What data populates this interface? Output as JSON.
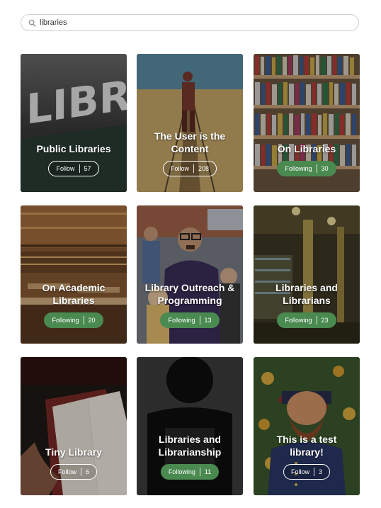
{
  "search": {
    "value": "libraries",
    "placeholder": ""
  },
  "cards": [
    {
      "title": "Public Libraries",
      "button_label": "Follow",
      "count": "57",
      "state": "follow"
    },
    {
      "title": "The User is the Content",
      "button_label": "Follow",
      "count": "208",
      "state": "follow"
    },
    {
      "title": "On Libraries",
      "button_label": "Following",
      "count": "30",
      "state": "following"
    },
    {
      "title": "On Academic Libraries",
      "button_label": "Following",
      "count": "20",
      "state": "following"
    },
    {
      "title": "Library Outreach & Programming",
      "button_label": "Following",
      "count": "13",
      "state": "following"
    },
    {
      "title": "Libraries and Librarians",
      "button_label": "Following",
      "count": "23",
      "state": "following"
    },
    {
      "title": "Tiny Library",
      "button_label": "Follow",
      "count": "6",
      "state": "follow"
    },
    {
      "title": "Libraries and Librarianship",
      "button_label": "Following",
      "count": "11",
      "state": "following"
    },
    {
      "title": "This is a test library!",
      "button_label": "Follow",
      "count": "3",
      "state": "follow"
    }
  ],
  "colors": {
    "following": "#4a8a50",
    "text": "#ffffff"
  }
}
